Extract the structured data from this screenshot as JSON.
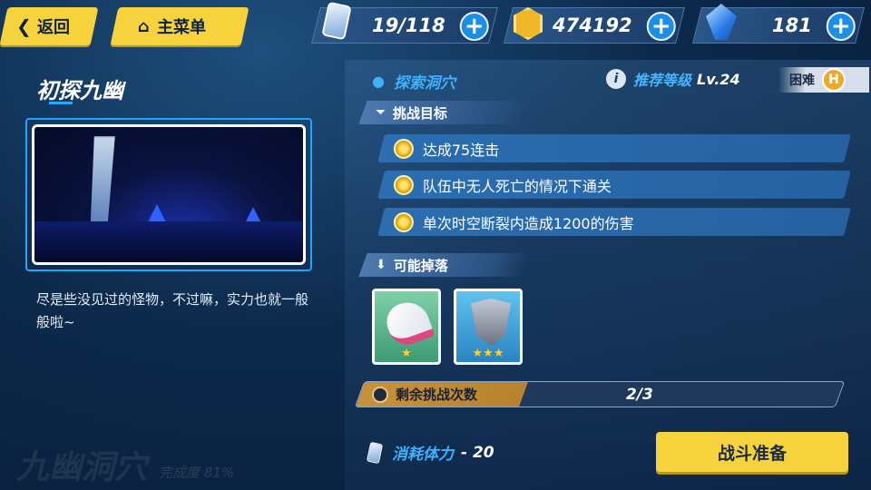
{
  "topbar": {
    "back_label": "返回",
    "menu_label": "主菜单",
    "resources": [
      {
        "icon": "stamina-icon",
        "value": "19/118"
      },
      {
        "icon": "gold-coin-icon",
        "value": "474192"
      },
      {
        "icon": "crystal-icon",
        "value": "181"
      }
    ]
  },
  "stage": {
    "title": "初探九幽",
    "description": "尽是些没见过的怪物，不过嘛，实力也就一般般啦~",
    "area_name": "九幽洞穴",
    "completion": "完成度 81%"
  },
  "info": {
    "location": "探索洞穴",
    "recommended_label": "推荐等级",
    "recommended_level": "Lv.24",
    "difficulty_label": "困难",
    "difficulty_badge": "H"
  },
  "objectives": {
    "title": "挑战目标",
    "items": [
      "达成75连击",
      "队伍中无人死亡的情况下通关",
      "单次时空断裂内造成1200的伤害"
    ]
  },
  "drops": {
    "title": "可能掉落",
    "items": [
      {
        "name": "helmet-item",
        "stars": "★",
        "bg": "#5fb88f"
      },
      {
        "name": "armor-item",
        "stars": "★★★",
        "bg": "#3fa3d8"
      }
    ]
  },
  "attempts": {
    "label": "剩余挑战次数",
    "value": "2/3",
    "fraction": 0.34
  },
  "cost": {
    "label": "消耗体力",
    "value": "- 20"
  },
  "battle_button": "战斗准备",
  "colors": {
    "accent": "#f6d23c",
    "panel": "#1a3a63",
    "goal_bar": "#2c6eb0"
  }
}
